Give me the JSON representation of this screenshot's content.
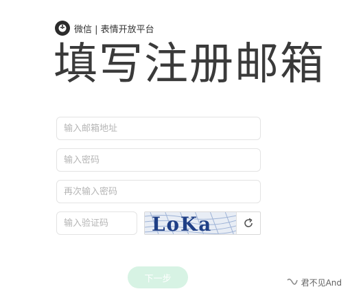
{
  "brand": {
    "logo_icon": "wechat-sticker-logo-icon",
    "text": "微信 | 表情开放平台"
  },
  "page": {
    "title": "填写注册邮箱"
  },
  "form": {
    "email_placeholder": "输入邮箱地址",
    "password_placeholder": "输入密码",
    "password_confirm_placeholder": "再次输入密码",
    "captcha_placeholder": "输入验证码",
    "captcha_image_text": "LoKa",
    "refresh_icon": "refresh-icon",
    "next_label": "下一步"
  },
  "watermark": {
    "icon": "wechat-channel-icon",
    "text": "君不见And"
  },
  "colors": {
    "next_button_bg": "#d7f3e4",
    "field_border": "#e3e3e3",
    "placeholder": "#b5b5b5"
  }
}
